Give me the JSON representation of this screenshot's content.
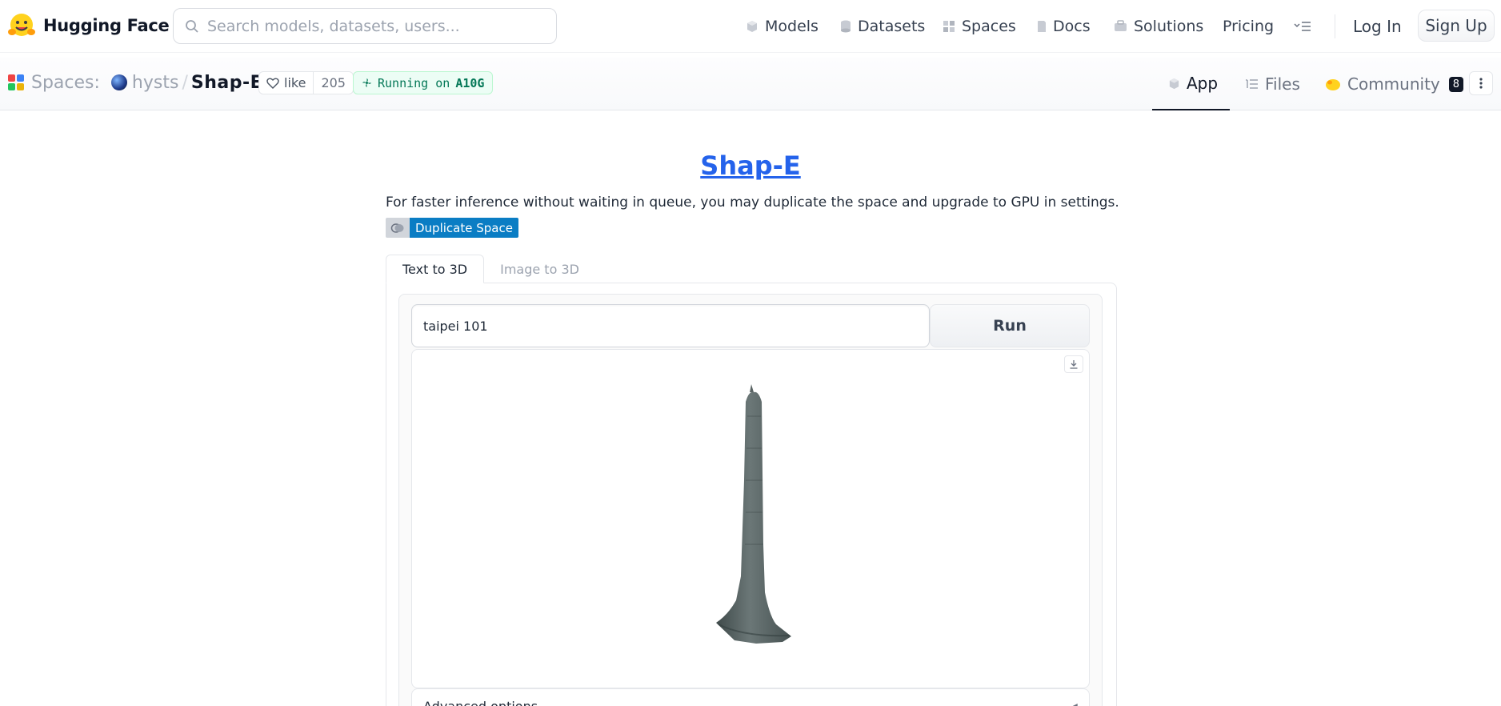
{
  "header": {
    "brand": "Hugging Face",
    "search_placeholder": "Search models, datasets, users...",
    "nav": [
      {
        "label": "Models",
        "icon": "cube-icon"
      },
      {
        "label": "Datasets",
        "icon": "database-icon"
      },
      {
        "label": "Spaces",
        "icon": "spaces-icon"
      },
      {
        "label": "Docs",
        "icon": "docs-icon"
      },
      {
        "label": "Solutions",
        "icon": "briefcase-icon"
      },
      {
        "label": "Pricing",
        "icon": ""
      }
    ],
    "login": "Log In",
    "signup": "Sign Up"
  },
  "space": {
    "section": "Spaces:",
    "owner": "hysts",
    "separator": "/",
    "name": "Shap-E",
    "like_label": "like",
    "like_count": "205",
    "status_prefix": "Running on",
    "hardware": "A10G",
    "tabs": [
      {
        "label": "App",
        "icon": "app-cube-icon",
        "active": true
      },
      {
        "label": "Files",
        "icon": "files-icon",
        "active": false
      },
      {
        "label": "Community",
        "icon": "community-icon",
        "active": false,
        "badge": "8"
      }
    ]
  },
  "app": {
    "title": "Shap-E",
    "description": "For faster inference without waiting in queue, you may duplicate the space and upgrade to GPU in settings.",
    "duplicate_label": "Duplicate Space",
    "tabs": [
      {
        "label": "Text to 3D",
        "active": true
      },
      {
        "label": "Image to 3D",
        "active": false
      }
    ],
    "prompt_value": "taipei 101",
    "run_label": "Run",
    "advanced_label": "Advanced options"
  },
  "colors": {
    "link_blue": "#2563eb",
    "duplicate_blue": "#0a7dc4",
    "running_green": "#047857",
    "model_gray": "#5f6b6b"
  }
}
